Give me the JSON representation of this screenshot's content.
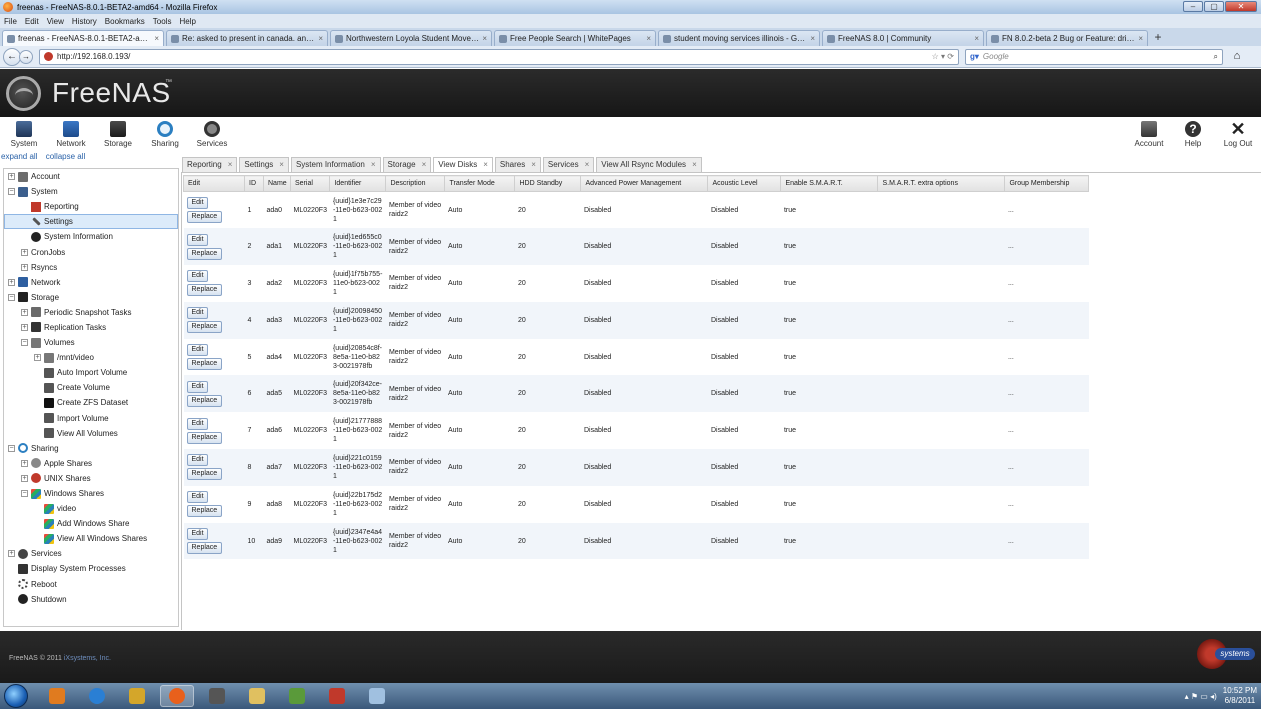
{
  "browser": {
    "window_title": "freenas - FreeNAS-8.0.1-BETA2-amd64 - Mozilla Firefox",
    "menu": [
      "File",
      "Edit",
      "View",
      "History",
      "Bookmarks",
      "Tools",
      "Help"
    ],
    "tabs": [
      {
        "label": "freenas - FreeNAS-8.0.1-BETA2-amd64",
        "active": true
      },
      {
        "label": "Re: asked to present in canada. any c...",
        "active": false
      },
      {
        "label": "Northwestern Loyola Student Movers...",
        "active": false
      },
      {
        "label": "Free People Search | WhitePages",
        "active": false
      },
      {
        "label": "student moving services illinois - Goo...",
        "active": false
      },
      {
        "label": "FreeNAS 8.0 | Community",
        "active": false
      },
      {
        "label": "FN 8.0.2-beta 2 Bug or Feature: drive ...",
        "active": false
      }
    ],
    "url": "http://192.168.0.193/",
    "search_placeholder": "Google"
  },
  "app": {
    "logo_text": "FreeNAS",
    "logo_tm": "™",
    "toolbar_left": [
      {
        "label": "System",
        "icon": "system-icon"
      },
      {
        "label": "Network",
        "icon": "network-icon"
      },
      {
        "label": "Storage",
        "icon": "storage-icon"
      },
      {
        "label": "Sharing",
        "icon": "sharing-icon"
      },
      {
        "label": "Services",
        "icon": "services-icon"
      }
    ],
    "toolbar_right": [
      {
        "label": "Account",
        "icon": "account-icon"
      },
      {
        "label": "Help",
        "icon": "help-icon"
      },
      {
        "label": "Log Out",
        "icon": "logout-icon"
      }
    ],
    "expand_all": "expand all",
    "collapse_all": "collapse all",
    "footer_copy": "FreeNAS © 2011",
    "footer_company": "iXsystems, Inc.",
    "footer_logo_word": "systems"
  },
  "tree": [
    {
      "label": "Account",
      "level": 0,
      "toggle": "+",
      "icon": "account-icon"
    },
    {
      "label": "System",
      "level": 0,
      "toggle": "−",
      "icon": "system-icon"
    },
    {
      "label": "Reporting",
      "level": 1,
      "toggle": "",
      "icon": "reporting-icon"
    },
    {
      "label": "Settings",
      "level": 1,
      "toggle": "",
      "icon": "settings-icon",
      "selected": true
    },
    {
      "label": "System Information",
      "level": 1,
      "toggle": "",
      "icon": "info-icon"
    },
    {
      "label": "CronJobs",
      "level": 1,
      "toggle": "+",
      "icon": ""
    },
    {
      "label": "Rsyncs",
      "level": 1,
      "toggle": "+",
      "icon": ""
    },
    {
      "label": "Network",
      "level": 0,
      "toggle": "+",
      "icon": "network-icon"
    },
    {
      "label": "Storage",
      "level": 0,
      "toggle": "−",
      "icon": "storage-icon"
    },
    {
      "label": "Periodic Snapshot Tasks",
      "level": 1,
      "toggle": "+",
      "icon": "snapshot-icon"
    },
    {
      "label": "Replication Tasks",
      "level": 1,
      "toggle": "+",
      "icon": "replication-icon"
    },
    {
      "label": "Volumes",
      "level": 1,
      "toggle": "−",
      "icon": "volumes-icon"
    },
    {
      "label": "/mnt/video",
      "level": 2,
      "toggle": "+",
      "icon": "volume-icon"
    },
    {
      "label": "Auto Import Volume",
      "level": 2,
      "toggle": "",
      "icon": "add-volume-icon"
    },
    {
      "label": "Create Volume",
      "level": 2,
      "toggle": "",
      "icon": "add-volume-icon"
    },
    {
      "label": "Create ZFS Dataset",
      "level": 2,
      "toggle": "",
      "icon": "dataset-icon"
    },
    {
      "label": "Import Volume",
      "level": 2,
      "toggle": "",
      "icon": "add-volume-icon"
    },
    {
      "label": "View All Volumes",
      "level": 2,
      "toggle": "",
      "icon": "add-volume-icon"
    },
    {
      "label": "Sharing",
      "level": 0,
      "toggle": "−",
      "icon": "sharing-icon"
    },
    {
      "label": "Apple Shares",
      "level": 1,
      "toggle": "+",
      "icon": "apple-icon"
    },
    {
      "label": "UNIX Shares",
      "level": 1,
      "toggle": "+",
      "icon": "unix-icon"
    },
    {
      "label": "Windows Shares",
      "level": 1,
      "toggle": "−",
      "icon": "windows-icon"
    },
    {
      "label": "video",
      "level": 2,
      "toggle": "",
      "icon": "windows-icon"
    },
    {
      "label": "Add Windows Share",
      "level": 2,
      "toggle": "",
      "icon": "windows-icon"
    },
    {
      "label": "View All Windows Shares",
      "level": 2,
      "toggle": "",
      "icon": "windows-icon"
    },
    {
      "label": "Services",
      "level": 0,
      "toggle": "+",
      "icon": "services-icon"
    },
    {
      "label": "Display System Processes",
      "level": 0,
      "toggle": "",
      "icon": "processes-icon"
    },
    {
      "label": "Reboot",
      "level": 0,
      "toggle": "",
      "icon": "reboot-icon"
    },
    {
      "label": "Shutdown",
      "level": 0,
      "toggle": "",
      "icon": "shutdown-icon"
    }
  ],
  "content_tabs": [
    "Reporting",
    "Settings",
    "System Information",
    "Storage",
    "View Disks",
    "Shares",
    "Services",
    "View All Rsync Modules"
  ],
  "active_content_tab": "View Disks",
  "disks": {
    "columns": [
      "Edit",
      "ID",
      "Name",
      "Serial",
      "Identifier",
      "Description",
      "Transfer Mode",
      "HDD Standby",
      "Advanced Power Management",
      "Acoustic Level",
      "Enable S.M.A.R.T.",
      "S.M.A.R.T. extra options",
      "Group Membership"
    ],
    "edit_label": "Edit",
    "replace_label": "Replace",
    "rows": [
      {
        "id": "1",
        "name": "ada0",
        "serial": "ML0220F3",
        "identifier": "{uuid}1e3e7c29-11e0-b623-0021",
        "description": "Member of video raidz2",
        "transfer": "Auto",
        "standby": "20",
        "apm": "Disabled",
        "acoustic": "Disabled",
        "smart": "true",
        "smart_extra": "",
        "group": "..."
      },
      {
        "id": "2",
        "name": "ada1",
        "serial": "ML0220F3",
        "identifier": "{uuid}1ed655c0-11e0-b623-0021",
        "description": "Member of video raidz2",
        "transfer": "Auto",
        "standby": "20",
        "apm": "Disabled",
        "acoustic": "Disabled",
        "smart": "true",
        "smart_extra": "",
        "group": "..."
      },
      {
        "id": "3",
        "name": "ada2",
        "serial": "ML0220F3",
        "identifier": "{uuid}1f75b755-11e0-b623-0021",
        "description": "Member of video raidz2",
        "transfer": "Auto",
        "standby": "20",
        "apm": "Disabled",
        "acoustic": "Disabled",
        "smart": "true",
        "smart_extra": "",
        "group": "..."
      },
      {
        "id": "4",
        "name": "ada3",
        "serial": "ML0220F3",
        "identifier": "{uuid}20098450-11e0-b623-0021",
        "description": "Member of video raidz2",
        "transfer": "Auto",
        "standby": "20",
        "apm": "Disabled",
        "acoustic": "Disabled",
        "smart": "true",
        "smart_extra": "",
        "group": "..."
      },
      {
        "id": "5",
        "name": "ada4",
        "serial": "ML0220F3",
        "identifier": "{uuid}20854c8f-8e5a-11e0-b823-0021978fb",
        "description": "Member of video raidz2",
        "transfer": "Auto",
        "standby": "20",
        "apm": "Disabled",
        "acoustic": "Disabled",
        "smart": "true",
        "smart_extra": "",
        "group": "..."
      },
      {
        "id": "6",
        "name": "ada5",
        "serial": "ML0220F3",
        "identifier": "{uuid}20f342ce-8e5a-11e0-b823-0021978fb",
        "description": "Member of video raidz2",
        "transfer": "Auto",
        "standby": "20",
        "apm": "Disabled",
        "acoustic": "Disabled",
        "smart": "true",
        "smart_extra": "",
        "group": "..."
      },
      {
        "id": "7",
        "name": "ada6",
        "serial": "ML0220F3",
        "identifier": "{uuid}21777888-11e0-b623-0021",
        "description": "Member of video raidz2",
        "transfer": "Auto",
        "standby": "20",
        "apm": "Disabled",
        "acoustic": "Disabled",
        "smart": "true",
        "smart_extra": "",
        "group": "..."
      },
      {
        "id": "8",
        "name": "ada7",
        "serial": "ML0220F3",
        "identifier": "{uuid}221c0159-11e0-b623-0021",
        "description": "Member of video raidz2",
        "transfer": "Auto",
        "standby": "20",
        "apm": "Disabled",
        "acoustic": "Disabled",
        "smart": "true",
        "smart_extra": "",
        "group": "..."
      },
      {
        "id": "9",
        "name": "ada8",
        "serial": "ML0220F3",
        "identifier": "{uuid}22b175d2-11e0-b623-0021",
        "description": "Member of video raidz2",
        "transfer": "Auto",
        "standby": "20",
        "apm": "Disabled",
        "acoustic": "Disabled",
        "smart": "true",
        "smart_extra": "",
        "group": "..."
      },
      {
        "id": "10",
        "name": "ada9",
        "serial": "ML0220F3",
        "identifier": "{uuid}2347e4a4-11e0-b623-0021",
        "description": "Member of video raidz2",
        "transfer": "Auto",
        "standby": "20",
        "apm": "Disabled",
        "acoustic": "Disabled",
        "smart": "true",
        "smart_extra": "",
        "group": "..."
      }
    ]
  },
  "taskbar": {
    "time": "10:52 PM",
    "date": "6/8/2011",
    "apps": [
      "windows-explorer-icon",
      "media-player-icon",
      "internet-explorer-icon",
      "app-icon",
      "firefox-icon",
      "calculator-icon",
      "folder-icon",
      "game-icon",
      "quicken-icon",
      "paint-icon"
    ]
  }
}
